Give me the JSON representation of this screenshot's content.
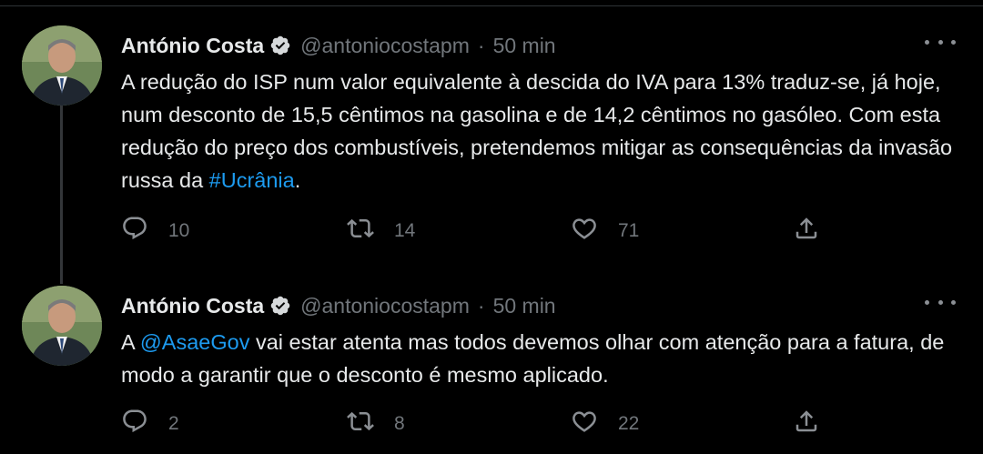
{
  "tweets": [
    {
      "author_name": "António Costa",
      "handle": "@antoniocostapm",
      "separator": "·",
      "time": "50 min",
      "text_before": "A redução do ISP num valor equivalente à descida do IVA para 13% traduz-se, já hoje, num desconto de 15,5 cêntimos na gasolina e de 14,2 cêntimos no gasóleo. Com esta redução do preço dos combustíveis, pretendemos mitigar as consequências da invasão russa da ",
      "link": "#Ucrânia",
      "text_after": ".",
      "replies": "10",
      "retweets": "14",
      "likes": "71"
    },
    {
      "author_name": "António Costa",
      "handle": "@antoniocostapm",
      "separator": "·",
      "time": "50 min",
      "text_before": "A ",
      "link": "@AsaeGov",
      "text_after": " vai estar atenta mas todos devemos olhar com atenção para a fatura, de modo a garantir que o desconto é mesmo aplicado.",
      "replies": "2",
      "retweets": "8",
      "likes": "22"
    }
  ],
  "icons": {
    "verified": "verified-badge-icon",
    "more": "more-options-icon",
    "reply": "reply-icon",
    "retweet": "retweet-icon",
    "like": "like-icon",
    "share": "share-icon"
  },
  "colors": {
    "background": "#000000",
    "text": "#e7e9ea",
    "secondary": "#71767b",
    "link": "#1d9bf0"
  }
}
